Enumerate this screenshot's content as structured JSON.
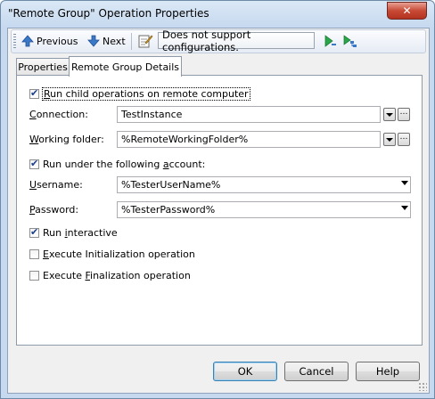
{
  "window": {
    "title": "\"Remote Group\" Operation Properties",
    "close_label": "✕"
  },
  "toolbar": {
    "previous_label": "Previous",
    "next_label": "Next",
    "config_label": "Does not support configurations."
  },
  "tabs": [
    {
      "label": "Properties",
      "active": false
    },
    {
      "label": "Remote Group Details",
      "active": true
    }
  ],
  "form": {
    "run_remote": {
      "label_pre": "",
      "label_u": "R",
      "label_post": "un child operations on remote computer",
      "checked": true
    },
    "connection": {
      "label_u": "C",
      "label_post": "onnection:",
      "value": "TestInstance"
    },
    "working_folder": {
      "label_u": "W",
      "label_post": "orking folder:",
      "value": "%RemoteWorkingFolder%"
    },
    "run_account": {
      "label_pre": "Run under the following ",
      "label_u": "a",
      "label_post": "ccount:",
      "checked": true
    },
    "username": {
      "label_u": "U",
      "label_post": "sername:",
      "value": "%TesterUserName%"
    },
    "password": {
      "label_u": "P",
      "label_post": "assword:",
      "value": "%TesterPassword%"
    },
    "run_interactive": {
      "label_pre": "Run ",
      "label_u": "i",
      "label_post": "nteractive",
      "checked": true
    },
    "exec_init": {
      "label_pre": "",
      "label_u": "E",
      "label_post": "xecute Initialization operation",
      "checked": false
    },
    "exec_final": {
      "label_pre": "Execute ",
      "label_u": "F",
      "label_post": "inalization operation",
      "checked": false
    }
  },
  "buttons": {
    "ok": "OK",
    "cancel": "Cancel",
    "help": "Help"
  }
}
